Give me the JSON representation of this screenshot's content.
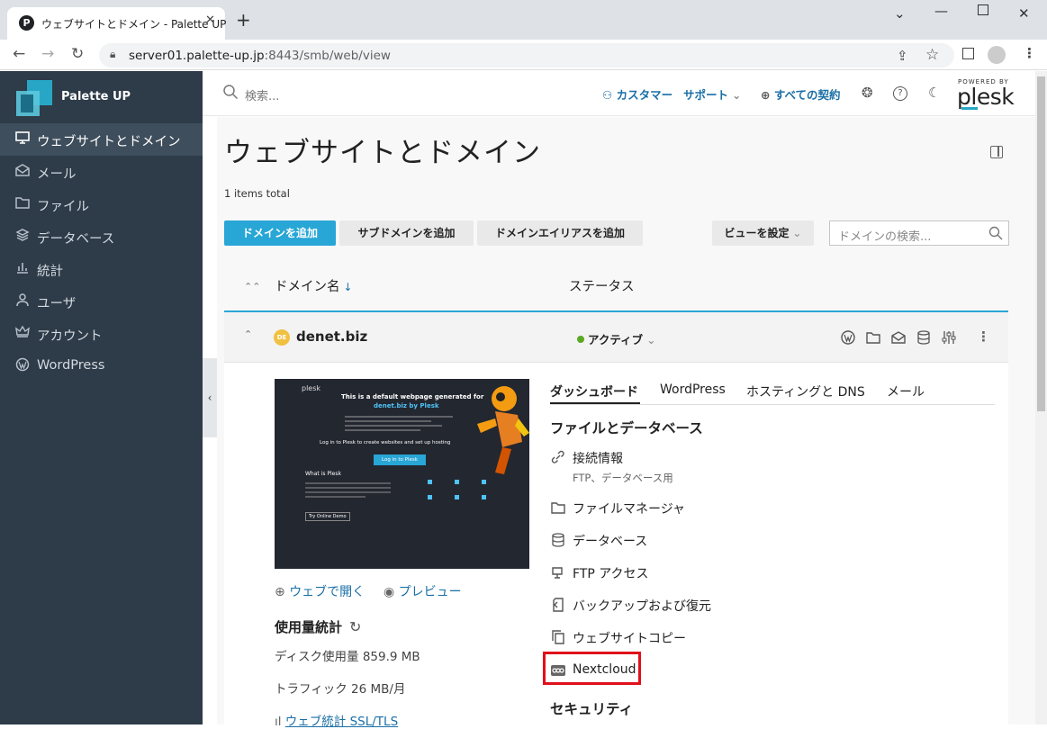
{
  "browser": {
    "tab_title": "ウェブサイトとドメイン - Palette UP",
    "tab_favicon": "P",
    "url_host": "server01.palette-up.jp",
    "url_rest": ":8443/smb/web/view"
  },
  "sidebar": {
    "brand": "Palette UP",
    "items": [
      {
        "label": "ウェブサイトとドメイン",
        "icon": "monitor-icon"
      },
      {
        "label": "メール",
        "icon": "mail-icon"
      },
      {
        "label": "ファイル",
        "icon": "folder-icon"
      },
      {
        "label": "データベース",
        "icon": "database-icon"
      },
      {
        "label": "統計",
        "icon": "bar-chart-icon"
      },
      {
        "label": "ユーザ",
        "icon": "user-icon"
      },
      {
        "label": "アカウント",
        "icon": "crown-icon"
      },
      {
        "label": "WordPress",
        "icon": "wordpress-icon"
      }
    ]
  },
  "topbar": {
    "search_placeholder": "検索...",
    "customer": "カスタマー",
    "support": "サポート",
    "subscriptions": "すべての契約",
    "powered_by": "POWERED BY",
    "plesk": "plesk"
  },
  "page": {
    "title": "ウェブサイトとドメイン",
    "items_total": "1 items total",
    "buttons": {
      "add_domain": "ドメインを追加",
      "add_subdomain": "サブドメインを追加",
      "add_alias": "ドメインエイリアスを追加",
      "view_settings": "ビューを設定"
    },
    "domain_search_placeholder": "ドメインの検索...",
    "columns": {
      "domain": "ドメイン名",
      "status": "ステータス"
    }
  },
  "domain": {
    "name": "denet.biz",
    "favicon": "DE",
    "status": "アクティブ",
    "open_web": "ウェブで開く",
    "preview": "プレビュー",
    "usage_title": "使用量統計",
    "disk": "ディスク使用量 859.9 MB",
    "traffic": "トラフィック 26 MB/月",
    "web_stats": "ウェブ統計 SSL/TLS",
    "preview_shot": {
      "brand": "plesk",
      "heading1": "This is a default webpage generated for",
      "heading2": "denet.biz by Plesk",
      "login": "Log in to Plesk to create websites and set up hosting",
      "button": "Log in to Plesk",
      "what": "What is Plesk",
      "demo": "Try Online Demo"
    },
    "tabs": [
      "ダッシュボード",
      "WordPress",
      "ホスティングと DNS",
      "メール"
    ],
    "section_files": "ファイルとデータベース",
    "tools": [
      {
        "label": "接続情報",
        "icon": "link-icon"
      },
      {
        "label": "ファイルマネージャ",
        "icon": "folder-icon"
      },
      {
        "label": "データベース",
        "icon": "database-icon"
      },
      {
        "label": "FTP アクセス",
        "icon": "ftp-icon"
      },
      {
        "label": "バックアップおよび復元",
        "icon": "backup-icon"
      },
      {
        "label": "ウェブサイトコピー",
        "icon": "copy-icon"
      },
      {
        "label": "Nextcloud",
        "icon": "nextcloud-icon"
      }
    ],
    "connection_sub": "FTP、データベース用",
    "section_security": "セキュリティ"
  },
  "colors": {
    "accent": "#28a6d6",
    "sidebar": "#2e3b48",
    "highlight": "#e0101a",
    "status_active": "#5aa923"
  }
}
